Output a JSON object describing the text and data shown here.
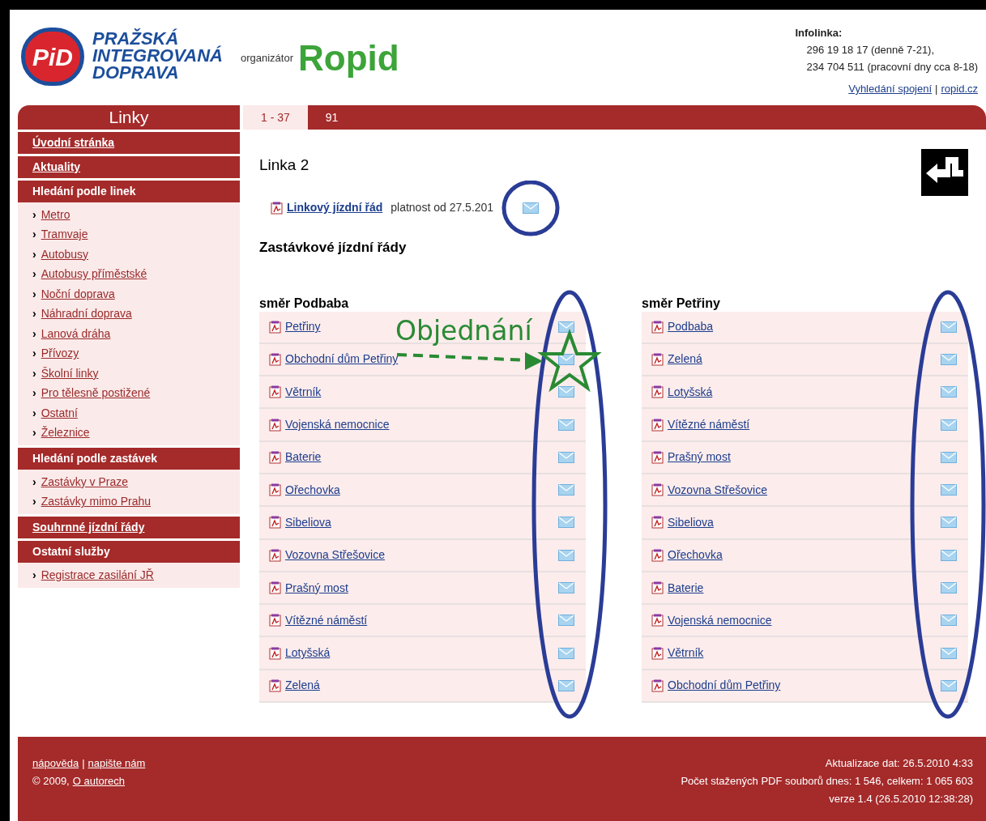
{
  "header": {
    "logo_text": "PiD",
    "brand_lines": [
      "PRAŽSKÁ",
      "INTEGROVANÁ",
      "DOPRAVA"
    ],
    "organizer_label": "organizátor",
    "organizer_logo": "Ropid",
    "infoline": {
      "title": "Infolinka:",
      "lines": [
        "296 19 18 17 (denně 7-21),",
        "234 704 511 (pracovní dny cca 8-18)"
      ],
      "links": [
        "Vyhledání spojení",
        "ropid.cz"
      ],
      "separator": "|"
    }
  },
  "sidebar": {
    "title": "Linky",
    "sections": [
      {
        "label": "Úvodní stránka",
        "link": true
      },
      {
        "label": "Aktuality",
        "link": true
      },
      {
        "label": "Hledání podle linek",
        "link": false,
        "children": [
          "Metro",
          "Tramvaje",
          "Autobusy",
          "Autobusy příměstské",
          "Noční doprava",
          "Náhradní doprava",
          "Lanová dráha",
          "Přívozy",
          "Školní linky",
          "Pro tělesně postižené",
          "Ostatní",
          "Železnice"
        ]
      },
      {
        "label": "Hledání podle zastávek",
        "link": false,
        "children": [
          "Zastávky v Praze",
          "Zastávky mimo Prahu"
        ]
      },
      {
        "label": "Souhrnné jízdní řády",
        "link": true
      },
      {
        "label": "Ostatní služby",
        "link": false,
        "children": [
          "Registrace zasilání JŘ"
        ]
      }
    ],
    "bullet": "›"
  },
  "tabs": [
    {
      "label": "1 - 37",
      "selected": true
    },
    {
      "label": "91",
      "selected": false
    }
  ],
  "line_title": "Linka 2",
  "line_timetable": {
    "link": "Linkový jízdní řád",
    "validity": "platnost od 27.5.201"
  },
  "stop_timetables_title": "Zastávkové jízdní řády",
  "directions": [
    {
      "title": "směr Podbaba",
      "stops": [
        "Petřiny",
        "Obchodní dům Petřiny",
        "Větrník",
        "Vojenská nemocnice",
        "Baterie",
        "Ořechovka",
        "Sibeliova",
        "Vozovna Střešovice",
        "Prašný most",
        "Vítězné náměstí",
        "Lotyšská",
        "Zelená"
      ]
    },
    {
      "title": "směr Petřiny",
      "stops": [
        "Podbaba",
        "Zelená",
        "Lotyšská",
        "Vítězné náměstí",
        "Prašný most",
        "Vozovna Střešovice",
        "Sibeliova",
        "Ořechovka",
        "Baterie",
        "Vojenská nemocnice",
        "Větrník",
        "Obchodní dům Petřiny"
      ]
    }
  ],
  "annotation": {
    "label": "Objednání"
  },
  "footer": {
    "links": [
      "nápověda",
      "napište nám"
    ],
    "separator": "|",
    "copyright": "© 2009,",
    "authors_link": "O autorech",
    "stats": [
      "Aktualizace dat: 26.5.2010 4:33",
      "Počet stažených PDF souborů dnes: 1 546, celkem: 1 065 603",
      "verze 1.4 (26.5.2010 12:38:28)"
    ]
  }
}
